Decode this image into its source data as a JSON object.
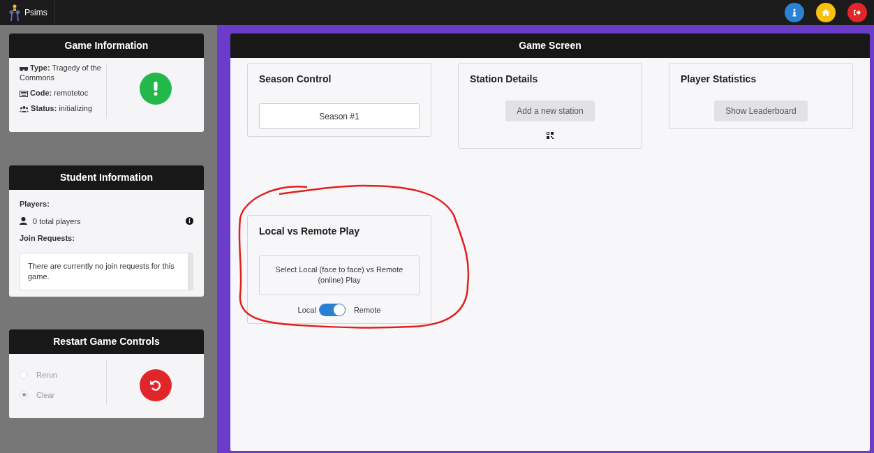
{
  "navbar": {
    "brand": "Psims",
    "buttons": [
      {
        "kind": "info",
        "color": "#2b82d3"
      },
      {
        "kind": "home",
        "color": "#f6c10f"
      },
      {
        "kind": "logout",
        "color": "#e0262a"
      }
    ]
  },
  "game_information": {
    "title": "Game Information",
    "items": [
      {
        "kind": "type",
        "label": "Type:",
        "value": "Tragedy of the Commons"
      },
      {
        "kind": "code",
        "label": "Code:",
        "value": "remotetoc"
      },
      {
        "kind": "status",
        "label": "Status:",
        "value": "initializing"
      }
    ],
    "status_indicator": {
      "kind": "alert",
      "color": "#22b84a"
    }
  },
  "student_information": {
    "title": "Student Information",
    "players_label": "Players:",
    "players_count": "0 total players",
    "join_label": "Join Requests:",
    "join_message": "There are currently no join requests for this game."
  },
  "restart_game_controls": {
    "title": "Restart Game Controls",
    "disabled": true,
    "options": [
      {
        "label": "Rerun",
        "selected": false
      },
      {
        "label": "Clear",
        "selected": true
      }
    ]
  },
  "game_screen": {
    "title": "Game Screen",
    "cards": [
      {
        "kind": "button",
        "title": "Season Control",
        "button": "Season #1"
      },
      {
        "kind": "station",
        "title": "Station Details",
        "button": "Add a new station"
      },
      {
        "kind": "button-grey",
        "title": "Player Statistics",
        "button": "Show Leaderboard"
      }
    ],
    "local_remote": {
      "title": "Local vs Remote Play",
      "description": "Select Local (face to face) vs Remote (online) Play",
      "left_label": "Local",
      "right_label": "Remote",
      "on": true
    },
    "annotation": {
      "kind": "freehand-circle",
      "color": "#e0201e"
    }
  }
}
